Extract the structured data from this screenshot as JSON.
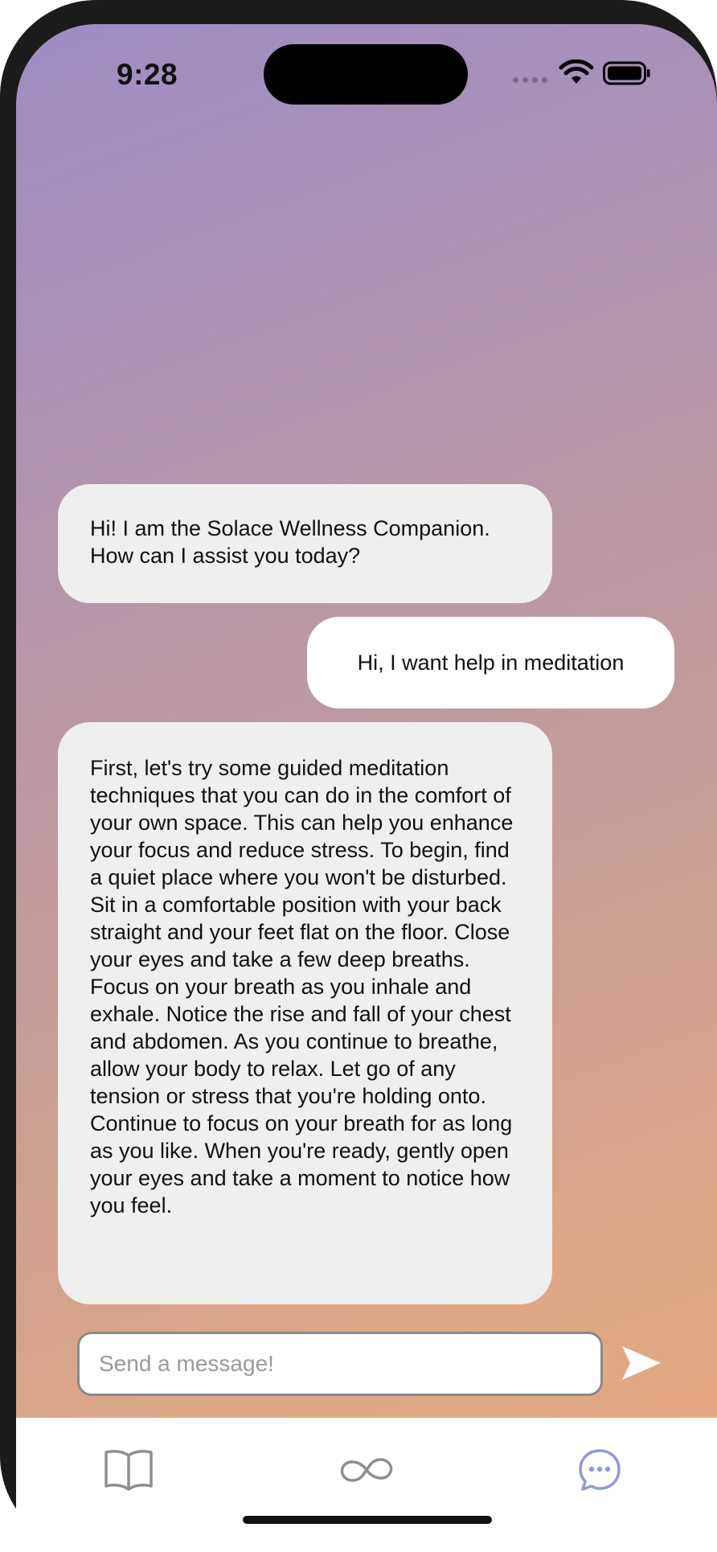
{
  "status_bar": {
    "time": "9:28",
    "icons": [
      "cellular-signal-icon",
      "wifi-icon",
      "battery-icon"
    ]
  },
  "chat": {
    "messages": [
      {
        "sender": "bot",
        "text": "Hi! I am the Solace Wellness Companion. How can I assist you today?"
      },
      {
        "sender": "user",
        "text": "Hi, I want help in meditation"
      },
      {
        "sender": "bot",
        "text": "First, let's try some guided meditation techniques that you can do in the comfort of your own space. This can help you enhance your focus and reduce stress. To begin, find a quiet place where you won't be disturbed. Sit in a comfortable position with your back straight and your feet flat on the floor. Close your eyes and take a few deep breaths. Focus on your breath as you inhale and exhale. Notice the rise and fall of your chest and abdomen. As you continue to breathe, allow your body to relax. Let go of any tension or stress that you're holding onto. Continue to focus on your breath for as long as you like. When you're ready, gently open your eyes and take a moment to notice how you feel."
      }
    ]
  },
  "composer": {
    "placeholder": "Send a message!",
    "value": "",
    "send_icon": "send-arrow-icon"
  },
  "tab_bar": {
    "tabs": [
      {
        "icon": "book-icon",
        "selected": false
      },
      {
        "icon": "infinity-icon",
        "selected": false
      },
      {
        "icon": "chat-bubble-icon",
        "selected": true
      }
    ]
  },
  "colors": {
    "gradient_top": "#9e8cc4",
    "gradient_bottom": "#eaaa7e",
    "bot_bubble": "#efefef",
    "user_bubble": "#ffffff",
    "tab_inactive": "#8f8f8f",
    "tab_active": "#8f9bd8",
    "send_icon": "#ffffff"
  }
}
